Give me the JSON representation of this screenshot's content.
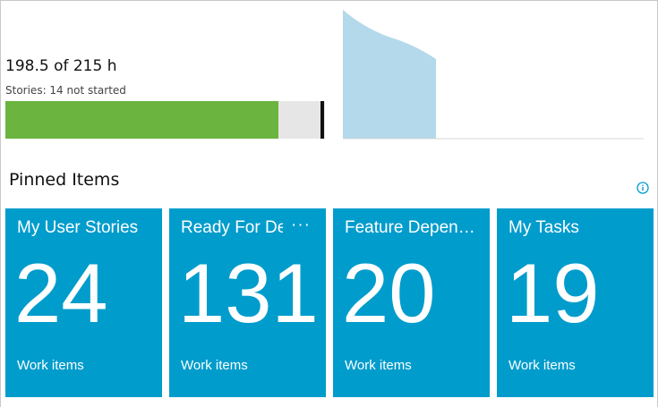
{
  "capacity": {
    "value_text": "198.5 of 215 h",
    "stories_text": "Stories: 14 not started",
    "completed_hours": 198.5,
    "total_hours": 215,
    "fill_color": "#6ab43f",
    "track_color": "#e6e6e6",
    "marker_color": "#111111"
  },
  "burndown": {
    "fill_color": "#b3d9ea",
    "icon": "burndown-area-chart"
  },
  "pinned": {
    "title": "Pinned Items",
    "info_icon": "info-icon",
    "tiles": [
      {
        "title": "My User Stories",
        "count": "24",
        "caption": "Work items"
      },
      {
        "title": "Ready For Dev",
        "count": "131",
        "caption": "Work items",
        "more": "···"
      },
      {
        "title": "Feature Depend...",
        "count": "20",
        "caption": "Work items"
      },
      {
        "title": "My Tasks",
        "count": "19",
        "caption": "Work items"
      }
    ],
    "tile_color": "#009ccc"
  }
}
